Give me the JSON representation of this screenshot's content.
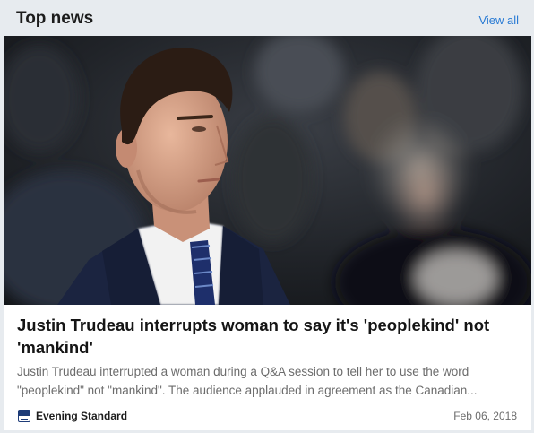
{
  "header": {
    "title": "Top news",
    "view_all_label": "View all"
  },
  "article": {
    "headline": "Justin Trudeau interrupts woman to say it's 'peoplekind' not 'mankind'",
    "summary": "Justin Trudeau interrupted a woman during a Q&A session to tell her to use the word \"peoplekind\" not \"mankind\". The audience applauded in agreement as the Canadian...",
    "source": "Evening Standard",
    "source_logo_icon": "evening-standard-logo-icon",
    "date": "Feb 06, 2018"
  },
  "colors": {
    "page_background": "#e7ebef",
    "link": "#2a7bd4",
    "headline": "#151515",
    "summary": "#6c6c6c"
  }
}
